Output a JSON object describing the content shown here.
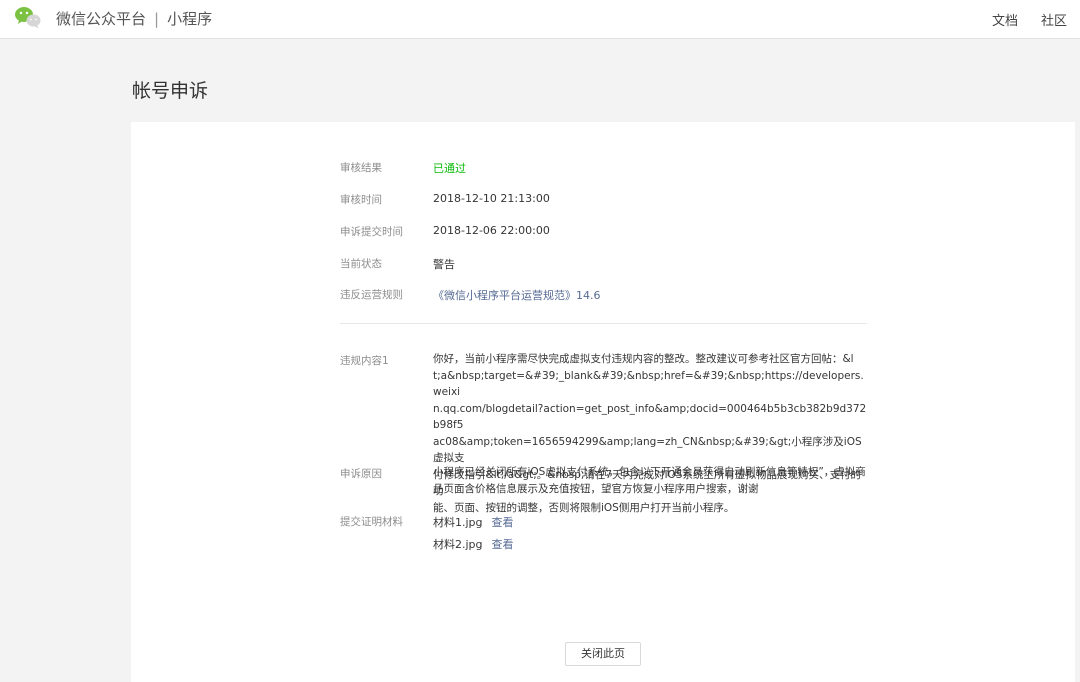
{
  "header": {
    "logo_icon": "wechat-icon",
    "brand_title": "微信公众平台",
    "separator": "|",
    "section": "小程序",
    "nav": [
      "文档",
      "社区"
    ]
  },
  "page": {
    "title": "帐号申诉"
  },
  "details": {
    "review_result": {
      "label": "审核结果",
      "value": "已通过",
      "color": "#09bb07"
    },
    "review_time": {
      "label": "审核时间",
      "value": "2018-12-10 21:13:00"
    },
    "submit_time": {
      "label": "申诉提交时间",
      "value": "2018-12-06 22:00:00"
    },
    "current_status": {
      "label": "当前状态",
      "value": "警告"
    },
    "violated_rule": {
      "label": "违反运营规则",
      "value": "《微信小程序平台运营规范》14.6",
      "color": "#576b95"
    }
  },
  "violation": {
    "label": "违规内容1",
    "lines": [
      "你好，当前小程序需尽快完成虚拟支付违规内容的整改。整改建议可参考社区官方回帖：&l",
      "t;a&nbsp;target=&#39;_blank&#39;&nbsp;href=&#39;&nbsp;https://developers.weixi",
      "n.qq.com/blogdetail?action=get_post_info&amp;docid=000464b5b3cb382b9d372b98f5",
      "ac08&amp;token=1656594299&amp;lang=zh_CN&nbsp;&#39;&gt;小程序涉及iOS虚拟支",
      "付修改指引&lt;/a&gt;。&nbsp;请在7天内完成对iOS系统上所有虚拟物品展现购买、支付的功",
      "能、页面、按钮的调整，否则将限制iOS侧用户打开当前小程序。"
    ]
  },
  "appeal": {
    "label": "申诉原因",
    "lines": [
      "小程序已经关闭所有iOS虚拟支付系统，包含以下开通会员获得自动刷新信息等特权”，虚拟商",
      "品页面含价格信息展示及充值按钮，望官方恢复小程序用户搜索，谢谢"
    ]
  },
  "materials": {
    "label": "提交证明材料",
    "files": [
      {
        "name": "材料1.jpg",
        "action": "查看"
      },
      {
        "name": "材料2.jpg",
        "action": "查看"
      }
    ]
  },
  "close_button": "关闭此页"
}
